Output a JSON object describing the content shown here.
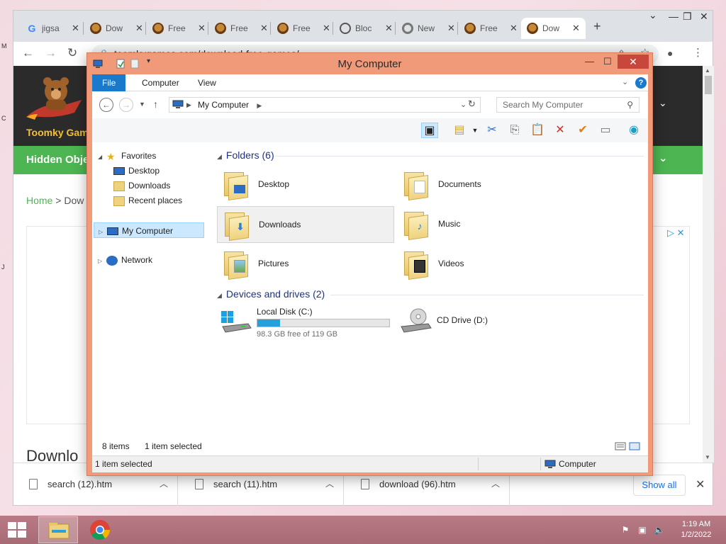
{
  "browser": {
    "tabs": [
      {
        "label": "jigsa",
        "icon": "google-icon"
      },
      {
        "label": "Dow",
        "icon": "bear-icon"
      },
      {
        "label": "Free",
        "icon": "bear-icon"
      },
      {
        "label": "Free",
        "icon": "bear-icon"
      },
      {
        "label": "Free",
        "icon": "bear-icon"
      },
      {
        "label": "Bloc",
        "icon": "globe-icon"
      },
      {
        "label": "New",
        "icon": "chrome-icon"
      },
      {
        "label": "Free",
        "icon": "bear-icon"
      },
      {
        "label": "Dow",
        "icon": "bear-icon",
        "active": true
      }
    ],
    "url": "toomkygames.com/download-free-games/",
    "page": {
      "logo_text": "Toomky Gam",
      "nav_label": "Hidden Obje",
      "breadcrumb_home": "Home",
      "breadcrumb_sep": ">",
      "breadcrumb_current": "Dow",
      "heading": "Downlo"
    },
    "downloads": [
      {
        "name": "search (12).htm"
      },
      {
        "name": "search (11).htm"
      },
      {
        "name": "download (96).htm"
      }
    ],
    "show_all": "Show all"
  },
  "explorer": {
    "title": "My Computer",
    "ribbon_tabs": [
      "File",
      "Computer",
      "View"
    ],
    "address": "My Computer",
    "search_placeholder": "Search My Computer",
    "nav": {
      "favorites": "Favorites",
      "desktop": "Desktop",
      "downloads": "Downloads",
      "recent": "Recent places",
      "my_computer": "My Computer",
      "network": "Network"
    },
    "folders_header": "Folders (6)",
    "folders": [
      {
        "name": "Desktop",
        "badge": "desktop-icon"
      },
      {
        "name": "Documents",
        "badge": "document-icon"
      },
      {
        "name": "Downloads",
        "badge": "download-arrow-icon",
        "selected": true
      },
      {
        "name": "Music",
        "badge": "music-note-icon"
      },
      {
        "name": "Pictures",
        "badge": "picture-icon"
      },
      {
        "name": "Videos",
        "badge": "film-icon"
      }
    ],
    "drives_header": "Devices and drives (2)",
    "drives": [
      {
        "name": "Local Disk (C:)",
        "free_text": "98.3 GB free of 119 GB",
        "used_fraction": 0.174
      },
      {
        "name": "CD Drive (D:)"
      }
    ],
    "status_items": "8 items",
    "status_selected": "1 item selected",
    "bottom_selected": "1 item selected",
    "bottom_location": "Computer"
  },
  "taskbar": {
    "time": "1:19 AM",
    "date": "1/2/2022"
  },
  "colors": {
    "explorer_frame": "#f09a7a",
    "accent_blue": "#1979ca",
    "site_green": "#4db552",
    "taskbar": "#b07280"
  }
}
